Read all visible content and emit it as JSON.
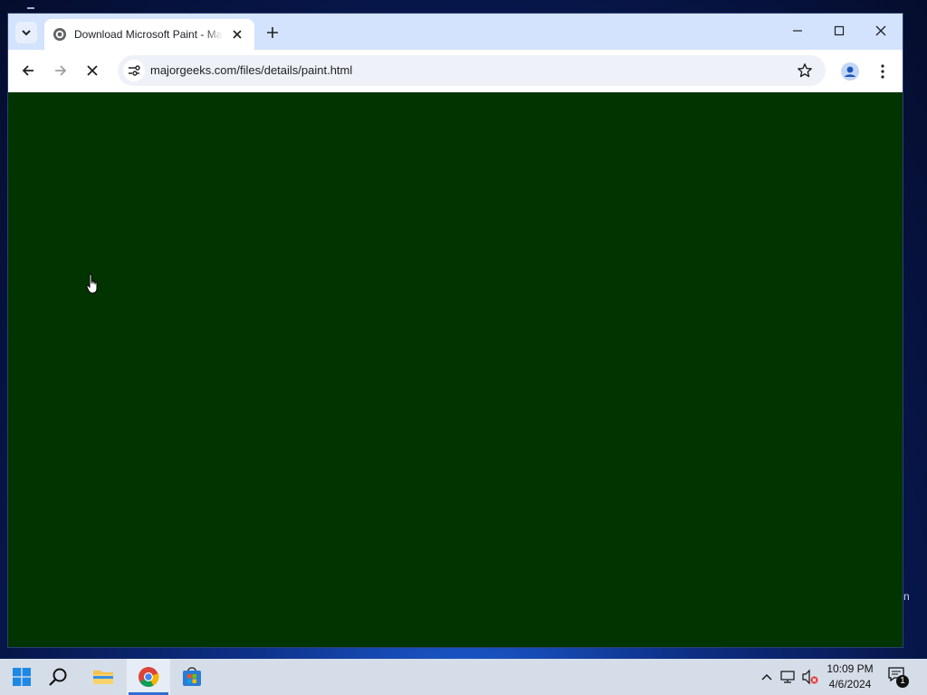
{
  "browser": {
    "tab": {
      "title": "Download Microsoft Paint - Ma"
    },
    "address_bar": {
      "url": "majorgeeks.com/files/details/paint.html"
    },
    "page": {
      "background_color": "#023400"
    }
  },
  "desktop": {
    "edge_text": "n"
  },
  "taskbar": {
    "apps": [
      "start-button",
      "search",
      "file-explorer",
      "chrome",
      "microsoft-store"
    ],
    "active_app": "chrome",
    "clock": {
      "time": "10:09 PM",
      "date": "4/6/2024"
    },
    "notifications": {
      "count": "1"
    }
  },
  "icons": {
    "tab_favicon": "globe-icon",
    "new_tab": "plus-icon",
    "back": "arrow-left-icon",
    "forward": "arrow-right-icon",
    "stop": "close-icon",
    "site_info": "tune-icon",
    "bookmark": "star-icon",
    "profile": "person-icon",
    "menu": "kebab-icon",
    "cursor": "hand-pointer-icon"
  },
  "colors": {
    "tabstrip": "#d3e3fd",
    "accent": "#2f6fd1"
  }
}
